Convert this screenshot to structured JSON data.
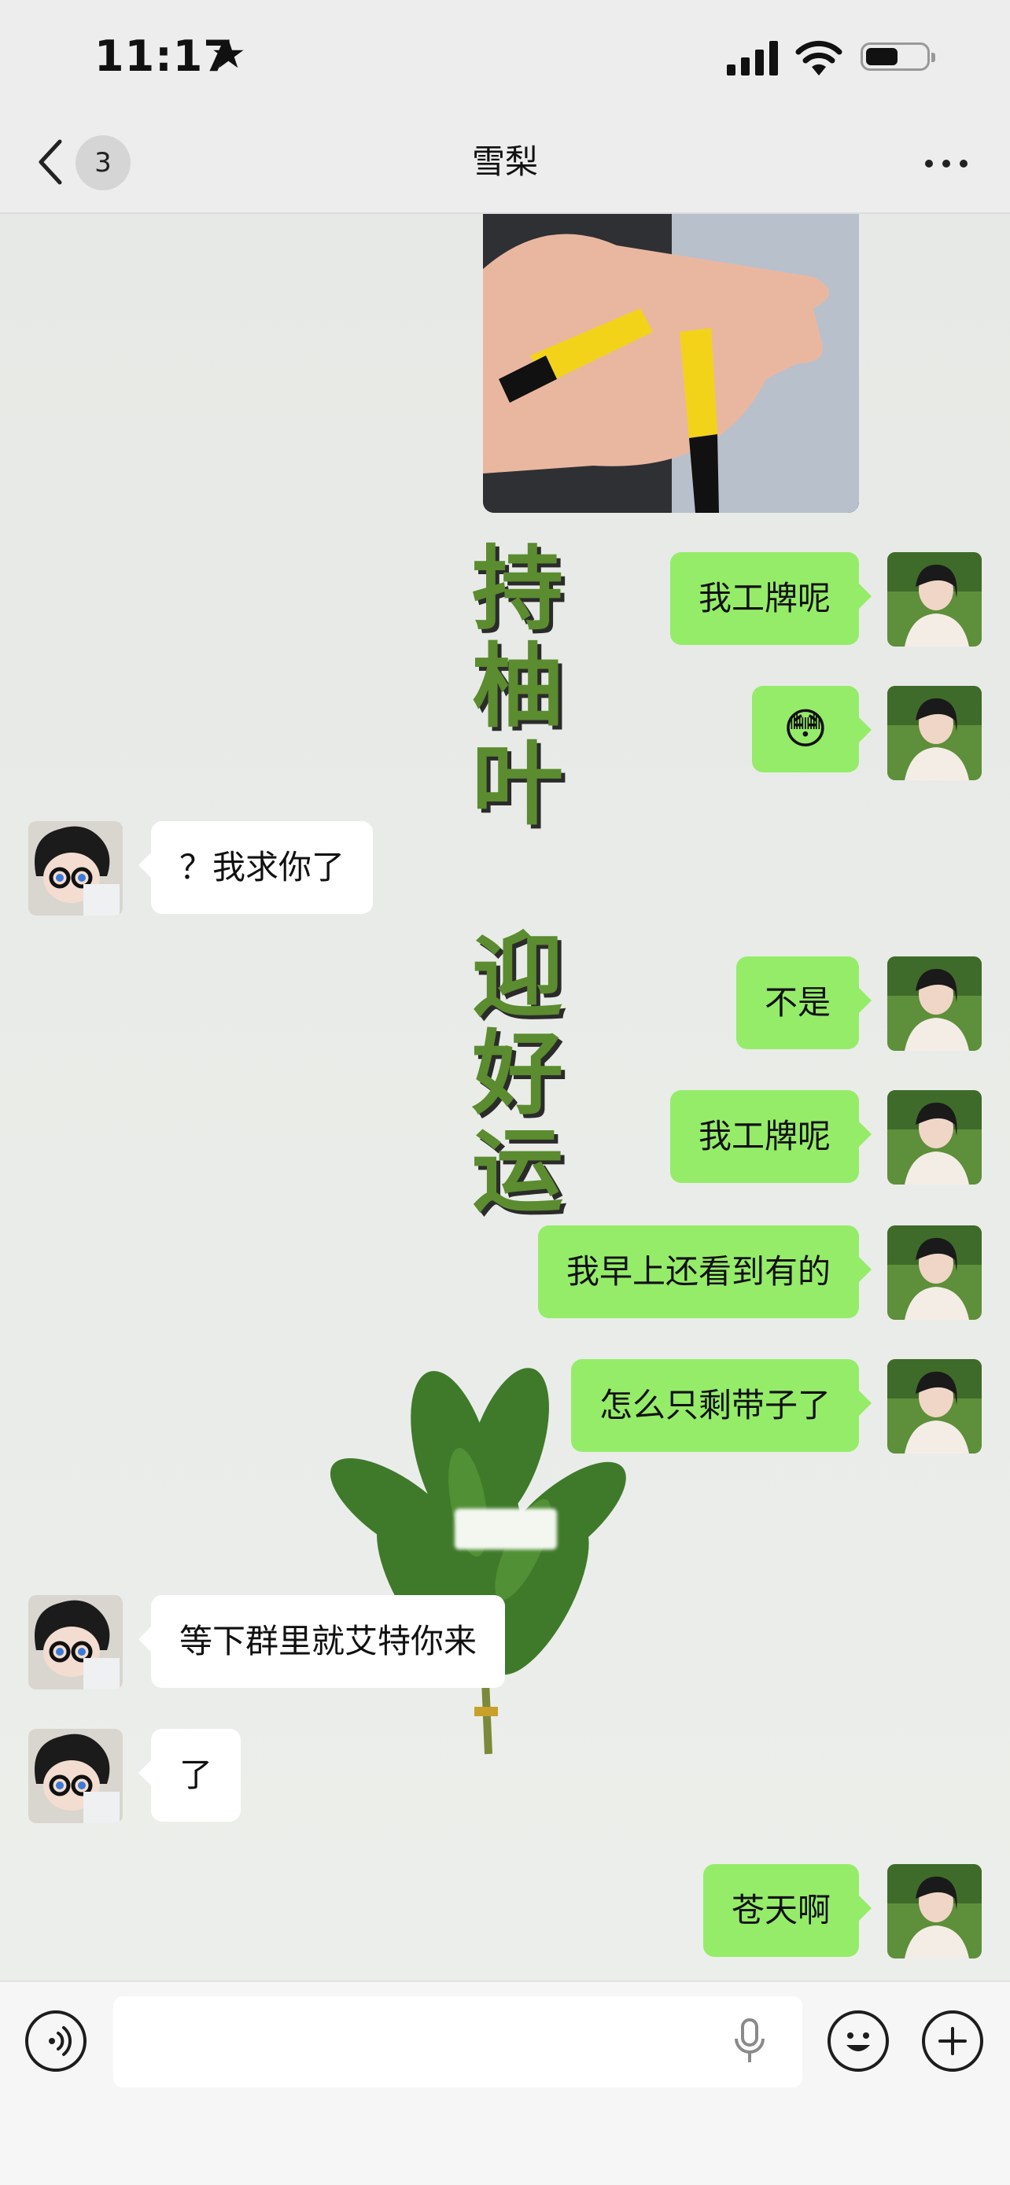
{
  "status_bar": {
    "time": "11:17",
    "star": "★"
  },
  "nav": {
    "back_badge": "3",
    "title": "雪梨"
  },
  "decoration": {
    "text_1": [
      "持",
      "柚",
      "叶"
    ],
    "text_2": [
      "迎",
      "好",
      "运"
    ]
  },
  "messages": [
    {
      "side": "me",
      "text": "我工牌呢"
    },
    {
      "side": "me",
      "text": "😳"
    },
    {
      "side": "other",
      "text": "？我求你了"
    },
    {
      "side": "me",
      "text": "不是"
    },
    {
      "side": "me",
      "text": "我工牌呢"
    },
    {
      "side": "me",
      "text": "我早上还看到有的"
    },
    {
      "side": "me",
      "text": "怎么只剩带子了"
    },
    {
      "side": "other",
      "text": "等下群里就艾特你来"
    },
    {
      "side": "other",
      "text": "了"
    },
    {
      "side": "me",
      "text": "苍天啊"
    }
  ],
  "input": {
    "placeholder": ""
  },
  "colors": {
    "my_bubble": "#95ec69",
    "their_bubble": "#ffffff",
    "decor_green": "#5b8c2f"
  }
}
